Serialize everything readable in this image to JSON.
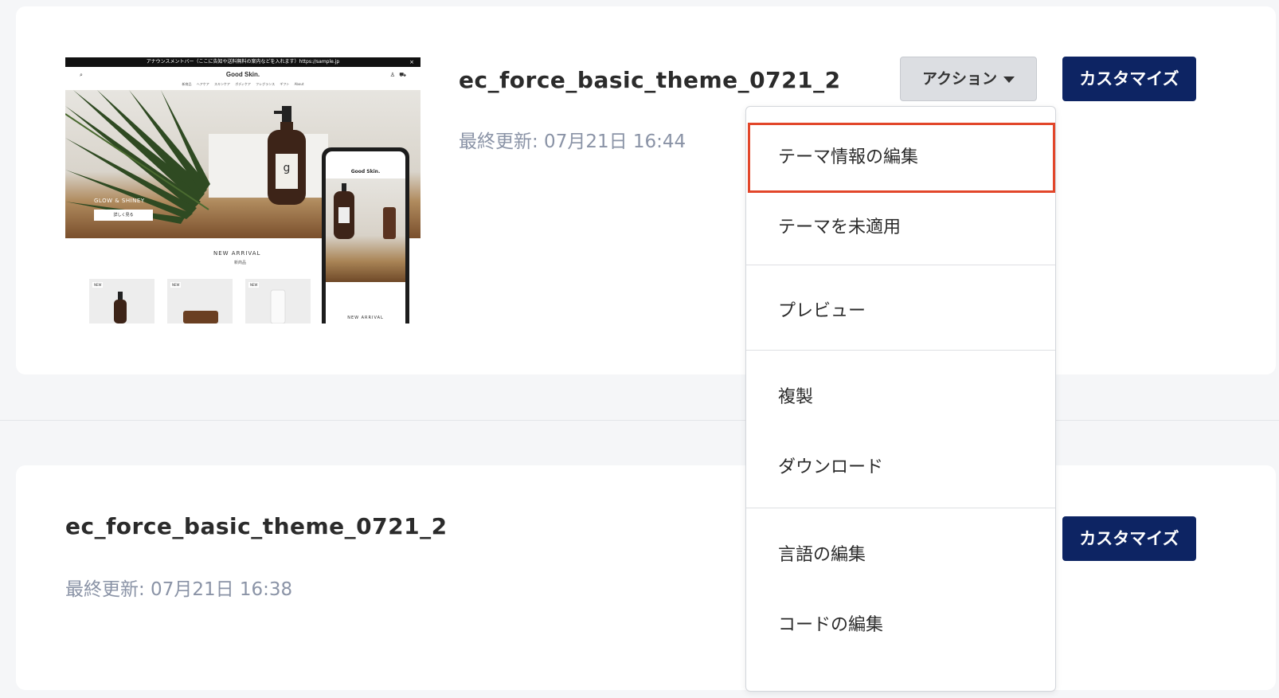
{
  "themes": [
    {
      "name": "ec_force_basic_theme_0721_2",
      "updated": "最終更新: 07月21日 16:44",
      "action_label": "アクション",
      "customize_label": "カスタマイズ"
    },
    {
      "name": "ec_force_basic_theme_0721_2",
      "updated": "最終更新: 07月21日 16:38",
      "customize_label": "カスタマイズ"
    }
  ],
  "preview": {
    "announcement": "アナウンスメントバー（ここに告知や送料無料の案内などを入れます）https://sample.jp",
    "logo": "Good Skin.",
    "nav": "新商品 ヘアケア スキンケア ボディケア フレグランス ギフト About",
    "hero_text": "GLOW & SHINEY",
    "hero_button": "詳しく見る",
    "new_arrival": "NEW ARRIVAL",
    "new_arrival_sub": "新商品",
    "new_tag": "NEW",
    "bottle_letter": "g"
  },
  "dropdown": {
    "items": [
      "テーマ情報の編集",
      "テーマを未適用",
      "プレビュー",
      "複製",
      "ダウンロード",
      "言語の編集",
      "コードの編集"
    ],
    "highlight_color": "#e2462a"
  },
  "colors": {
    "primary": "#0d2463",
    "muted_text": "#8a93a6"
  }
}
